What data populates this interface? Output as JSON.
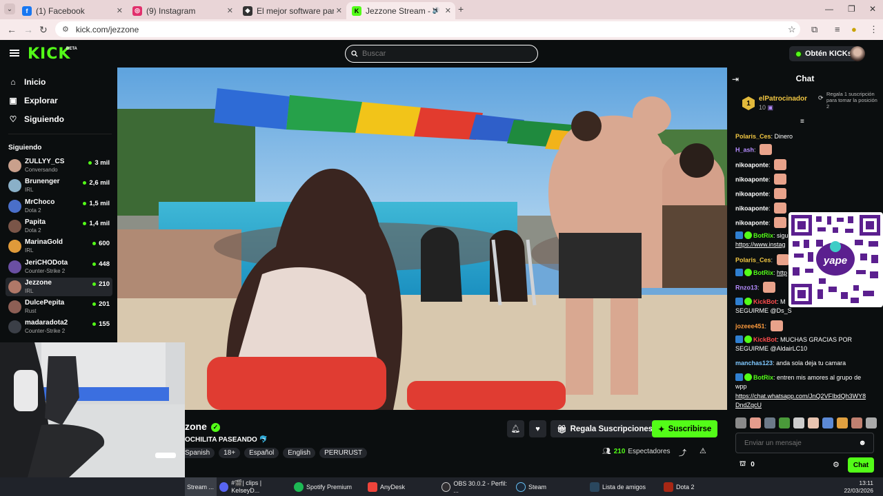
{
  "browser": {
    "tabs": [
      {
        "label": "(1) Facebook",
        "icon": "facebook-icon",
        "color": "#1877f2"
      },
      {
        "label": "(9) Instagram",
        "icon": "instagram-icon",
        "color": "#e1306c"
      },
      {
        "label": "El mejor software para potencia",
        "icon": "software-icon",
        "color": "#333333"
      },
      {
        "label": "Jezzone Stream - Watch Liv",
        "icon": "kick-icon",
        "color": "#53fc18"
      }
    ],
    "url": "kick.com/jezzone"
  },
  "header": {
    "logo": "KICK",
    "logo_badge": "BETA",
    "search_placeholder": "Buscar",
    "kicks_label": "Obtén KICKs"
  },
  "sidebar": {
    "nav": [
      {
        "label": "Inicio",
        "icon": "home-icon"
      },
      {
        "label": "Explorar",
        "icon": "explore-icon"
      },
      {
        "label": "Siguiendo",
        "icon": "heart-icon"
      }
    ],
    "following_title": "Siguiendo",
    "following": [
      {
        "name": "ZULLYY_CS",
        "category": "Conversando",
        "viewers": "3 mil"
      },
      {
        "name": "Brunenger",
        "category": "IRL",
        "viewers": "2,6 mil"
      },
      {
        "name": "MrChoco",
        "category": "Dota 2",
        "viewers": "1,5 mil"
      },
      {
        "name": "Papita",
        "category": "Dota 2",
        "viewers": "1,4 mil"
      },
      {
        "name": "MarinaGold",
        "category": "IRL",
        "viewers": "600"
      },
      {
        "name": "JeriCHODota",
        "category": "Counter-Strike 2",
        "viewers": "448"
      },
      {
        "name": "Jezzone",
        "category": "IRL",
        "viewers": "210"
      },
      {
        "name": "DulcePepita",
        "category": "Rust",
        "viewers": "201"
      },
      {
        "name": "madaradota2",
        "category": "Counter-Strike 2",
        "viewers": "155"
      }
    ]
  },
  "stream": {
    "name": "zone",
    "title": "OCHILITA PASEANDO",
    "tags": [
      "Spanish",
      "18+",
      "Español",
      "English",
      "PERURUST"
    ],
    "gift_label": "Regala Suscripciones",
    "subscribe_label": "Suscribirse",
    "viewer_count": "210",
    "viewer_label": "Espectadores"
  },
  "chat": {
    "title": "Chat",
    "pinned": {
      "rank": "1",
      "name": "elPatrocinador",
      "count": "10",
      "cta": "Regala 1 suscripción para tomar la posición 2"
    },
    "messages": [
      {
        "user": "Polaris_Ces",
        "color": "#f3c843",
        "text": "Dinero"
      },
      {
        "user": "H_ash",
        "color": "#b58cff",
        "text": ""
      },
      {
        "user": "nikoaponte",
        "color": "#ffffff",
        "text": ""
      },
      {
        "user": "nikoaponte",
        "color": "#ffffff",
        "text": ""
      },
      {
        "user": "nikoaponte",
        "color": "#ffffff",
        "text": ""
      },
      {
        "user": "nikoaponte",
        "color": "#ffffff",
        "text": ""
      },
      {
        "user": "nikoaponte",
        "color": "#ffffff",
        "text": ""
      },
      {
        "user": "BotRix",
        "color": "#53fc18",
        "text": "sigu"
      },
      {
        "user": "",
        "color": "#ffffff",
        "text": "https://www.instag"
      },
      {
        "user": "Polaris_Ces",
        "color": "#f3c843",
        "text": ""
      },
      {
        "user": "BotRix",
        "color": "#53fc18",
        "text": "http"
      },
      {
        "user": "Rnzo13",
        "color": "#b58cff",
        "text": ""
      },
      {
        "user": "KickBot",
        "color": "#ff4c4c",
        "text": "M"
      },
      {
        "user": "",
        "color": "#ffffff",
        "text": "SEGUIRME @Ds_S"
      },
      {
        "user": "jozeee451",
        "color": "#ff9b3d",
        "text": ""
      },
      {
        "user": "KickBot",
        "color": "#ff4c4c",
        "text": "MUCHAS GRACIAS POR"
      },
      {
        "user": "",
        "color": "#ffffff",
        "text": "SEGUIRME @AldairLC10"
      },
      {
        "user": "manchas123",
        "color": "#7fc8ff",
        "text": "anda sola deja tu camara"
      },
      {
        "user": "BotRix",
        "color": "#53fc18",
        "text": "entren mis amores al grupo de"
      },
      {
        "user": "",
        "color": "#ffffff",
        "text": "wpp"
      },
      {
        "user": "",
        "color": "#ffffff",
        "text": "https://chat.whatsapp.com/JnQ2VFIbdQh3WY8"
      },
      {
        "user": "",
        "color": "#ffffff",
        "text": "DndZqcU"
      }
    ],
    "qr_label": "yape",
    "input_placeholder": "Enviar un mensaje",
    "points": "0",
    "send_label": "Chat"
  },
  "taskbar": {
    "items": [
      {
        "label": "Stream ...",
        "color": "#3a4350"
      },
      {
        "label": "#🎬| clips | KelseyD...",
        "color": "#5865f2"
      },
      {
        "label": "Spotify Premium",
        "color": "#1db954"
      },
      {
        "label": "AnyDesk",
        "color": "#ef443b"
      },
      {
        "label": "OBS 30.0.2 - Perfil: ...",
        "color": "#302e31"
      },
      {
        "label": "Steam",
        "color": "#1b2838"
      },
      {
        "label": "Lista de amigos",
        "color": "#2a475e"
      },
      {
        "label": "Dota 2",
        "color": "#a72714"
      }
    ],
    "time": "13:11",
    "date": "22/03/2026"
  }
}
